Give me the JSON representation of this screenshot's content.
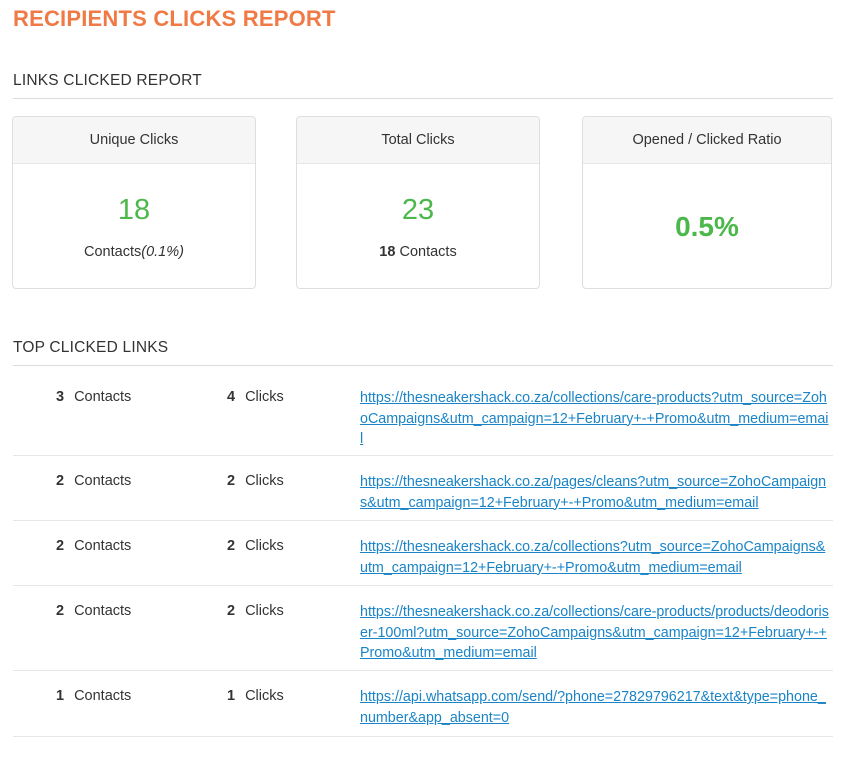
{
  "page_title": "RECIPIENTS CLICKS REPORT",
  "links_section_title": "LINKS CLICKED REPORT",
  "cards": {
    "unique": {
      "title": "Unique Clicks",
      "value": "18",
      "sub_label": "Contacts",
      "sub_percent": "(0.1%)"
    },
    "total": {
      "title": "Total Clicks",
      "value": "23",
      "sub_count": "18",
      "sub_label": "Contacts"
    },
    "ratio": {
      "title": "Opened / Clicked Ratio",
      "value": "0.5%"
    }
  },
  "top_links_title": "TOP CLICKED LINKS",
  "top_links": [
    {
      "contacts": "3",
      "contacts_label": "Contacts",
      "clicks": "4",
      "clicks_label": "Clicks",
      "url": "https://thesneakershack.co.za/collections/care-products?utm_source=ZohoCampaigns&utm_campaign=12+February+-+Promo&utm_medium=email"
    },
    {
      "contacts": "2",
      "contacts_label": "Contacts",
      "clicks": "2",
      "clicks_label": "Clicks",
      "url": "https://thesneakershack.co.za/pages/cleans?utm_source=ZohoCampaigns&utm_campaign=12+February+-+Promo&utm_medium=email"
    },
    {
      "contacts": "2",
      "contacts_label": "Contacts",
      "clicks": "2",
      "clicks_label": "Clicks",
      "url": "https://thesneakershack.co.za/collections?utm_source=ZohoCampaigns&utm_campaign=12+February+-+Promo&utm_medium=email"
    },
    {
      "contacts": "2",
      "contacts_label": "Contacts",
      "clicks": "2",
      "clicks_label": "Clicks",
      "url": "https://thesneakershack.co.za/collections/care-products/products/deodoriser-100ml?utm_source=ZohoCampaigns&utm_campaign=12+February+-+Promo&utm_medium=email"
    },
    {
      "contacts": "1",
      "contacts_label": "Contacts",
      "clicks": "1",
      "clicks_label": "Clicks",
      "url": "https://api.whatsapp.com/send/?phone=27829796217&text&type=phone_number&app_absent=0"
    }
  ]
}
